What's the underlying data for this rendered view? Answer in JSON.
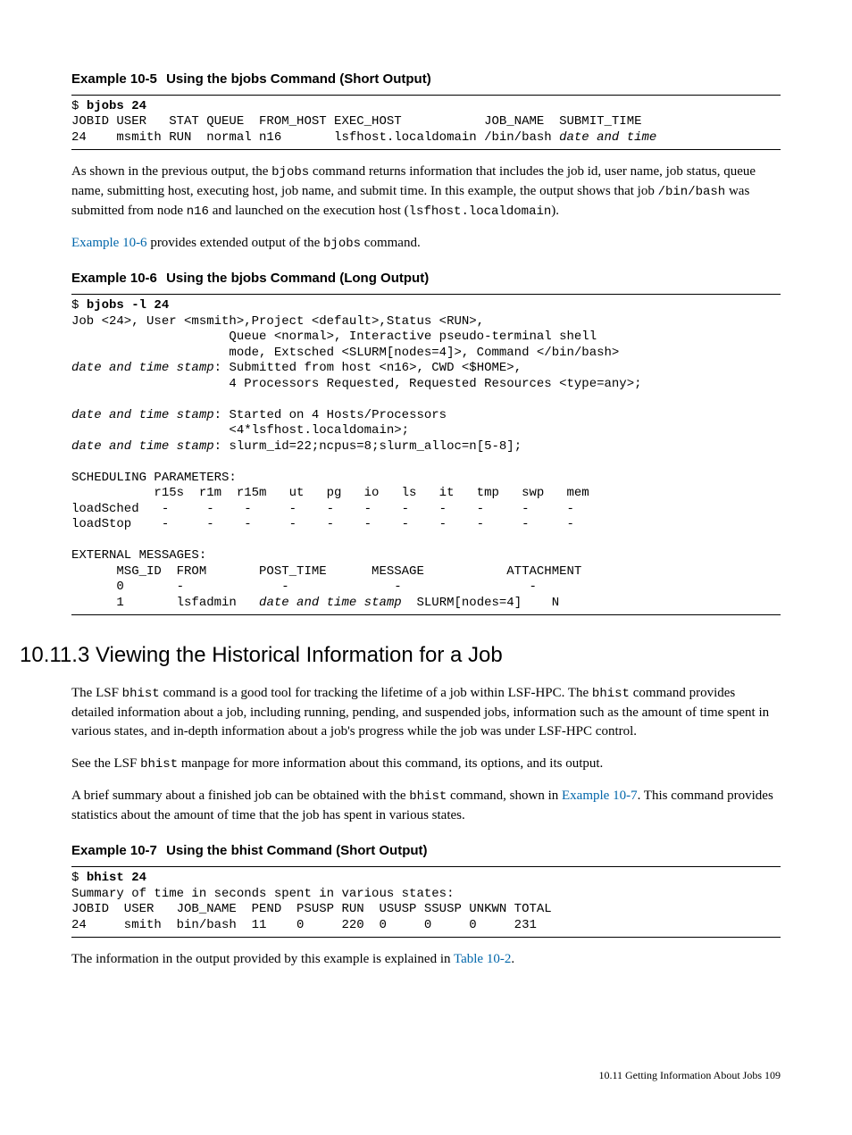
{
  "ex5": {
    "title_pre": "Example 10-5",
    "title_txt": "Using the bjobs Command (Short Output)"
  },
  "code5_l1a": "$ ",
  "code5_l1b": "bjobs 24",
  "code5_l2": "JOBID USER   STAT QUEUE  FROM_HOST EXEC_HOST           JOB_NAME  SUBMIT_TIME",
  "code5_l3a": "24    msmith RUN  normal n16       lsfhost.localdomain /bin/bash ",
  "code5_l3b": "date and time",
  "p1_a": "As shown in the previous output, the ",
  "p1_b": "bjobs",
  "p1_c": " command returns information that includes the job id, user name, job status, queue name, submitting host, executing host, job name, and submit time. In this example, the output shows that job ",
  "p1_d": "/bin/bash",
  "p1_e": " was submitted from node ",
  "p1_f": "n16",
  "p1_g": " and launched on the execution host (",
  "p1_h": "lsfhost.localdomain",
  "p1_i": ").",
  "p2_a": "Example 10-6",
  "p2_b": " provides extended output of the ",
  "p2_c": "bjobs",
  "p2_d": " command.",
  "ex6": {
    "title_pre": "Example 10-6",
    "title_txt": "Using the bjobs Command (Long Output)"
  },
  "c6_l1a": "$ ",
  "c6_l1b": "bjobs -l 24",
  "c6_l2": "Job <24>, User <msmith>,Project <default>,Status <RUN>,",
  "c6_l3": "                     Queue <normal>, Interactive pseudo-terminal shell",
  "c6_l4": "                     mode, Extsched <SLURM[nodes=4]>, Command </bin/bash>",
  "c6_l5a": "date and time stamp",
  "c6_l5b": ": Submitted from host <n16>, CWD <$HOME>,",
  "c6_l6": "                     4 Processors Requested, Requested Resources <type=any>;",
  "c6_blank1": "",
  "c6_l7a": "date and time stamp",
  "c6_l7b": ": Started on 4 Hosts/Processors",
  "c6_l8": "                     <4*lsfhost.localdomain>;",
  "c6_l9a": "date and time stamp",
  "c6_l9b": ": slurm_id=22;ncpus=8;slurm_alloc=n[5-8];",
  "c6_blank2": "",
  "c6_l10": "SCHEDULING PARAMETERS:",
  "c6_l11": "           r15s  r1m  r15m   ut   pg   io   ls   it   tmp   swp   mem",
  "c6_l12": "loadSched   -     -    -     -    -    -    -    -    -     -     -",
  "c6_l13": "loadStop    -     -    -     -    -    -    -    -    -     -     -",
  "c6_blank3": "",
  "c6_l14": "EXTERNAL MESSAGES:",
  "c6_l15": "      MSG_ID  FROM       POST_TIME      MESSAGE           ATTACHMENT",
  "c6_l16": "      0       -             -              -                 -",
  "c6_l17a": "      1       lsfadmin   ",
  "c6_l17b": "date and time stamp",
  "c6_l17c": "  SLURM[nodes=4]    N",
  "section": "10.11.3  Viewing the Historical Information for a Job",
  "p3_a": "The LSF ",
  "p3_b": "bhist",
  "p3_c": " command is a good tool for tracking the lifetime of a job within LSF-HPC. The ",
  "p3_d": "bhist",
  "p3_e": " command provides detailed information about a job, including running, pending, and suspended jobs, information such as the amount of time spent in various states, and in-depth information about a job's progress while the job was under LSF-HPC control.",
  "p4_a": "See the LSF ",
  "p4_b": "bhist",
  "p4_c": " manpage for more information about this command, its options, and its output.",
  "p5_a": "A brief summary about a finished job can be obtained with the ",
  "p5_b": "bhist",
  "p5_c": " command, shown in ",
  "p5_d": "Example 10-7",
  "p5_e": ". This command provides statistics about the amount of time that the job has spent in various states.",
  "ex7": {
    "title_pre": "Example 10-7",
    "title_txt": "Using the bhist Command (Short Output)"
  },
  "c7_l1a": "$ ",
  "c7_l1b": "bhist 24",
  "c7_l2": "Summary of time in seconds spent in various states:",
  "c7_l3": "JOBID  USER   JOB_NAME  PEND  PSUSP RUN  USUSP SSUSP UNKWN TOTAL",
  "c7_l4": "24     smith  bin/bash  11    0     220  0     0     0     231",
  "p6_a": "The information in the output provided by this example is explained in ",
  "p6_b": "Table 10-2",
  "p6_c": ".",
  "footer": "10.11 Getting Information About Jobs    109"
}
